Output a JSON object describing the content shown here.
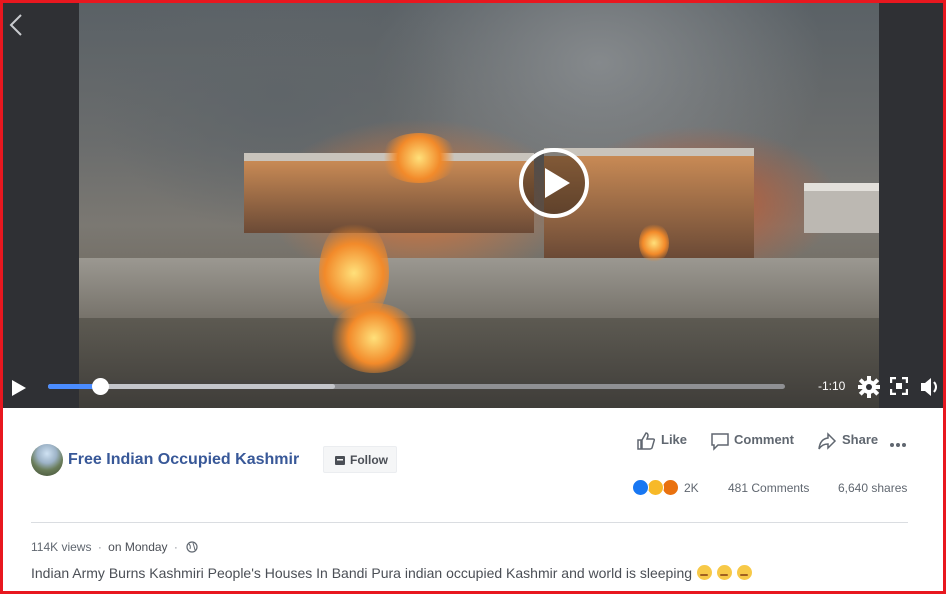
{
  "player": {
    "time_remaining": "-1:10",
    "progress": 0.07,
    "buffered": 0.39,
    "icons": [
      "back-arrow-icon",
      "play-icon",
      "gear-icon",
      "fullscreen-icon",
      "volume-icon"
    ]
  },
  "page": {
    "name": "Free Indian Occupied Kashmir",
    "follow_label": "Follow"
  },
  "actions": {
    "like": "Like",
    "comment": "Comment",
    "share": "Share"
  },
  "stats": {
    "reactions": "2K",
    "comments": "481 Comments",
    "shares": "6,640 shares"
  },
  "meta": {
    "views": "114K views",
    "separator": "·",
    "posted": "on Monday"
  },
  "caption": "Indian Army Burns Kashmiri People's Houses In Bandi Pura indian occupied Kashmir and world is sleeping",
  "colors": {
    "link": "#385898",
    "progress": "#4a8cff",
    "border": "#e8171f"
  }
}
